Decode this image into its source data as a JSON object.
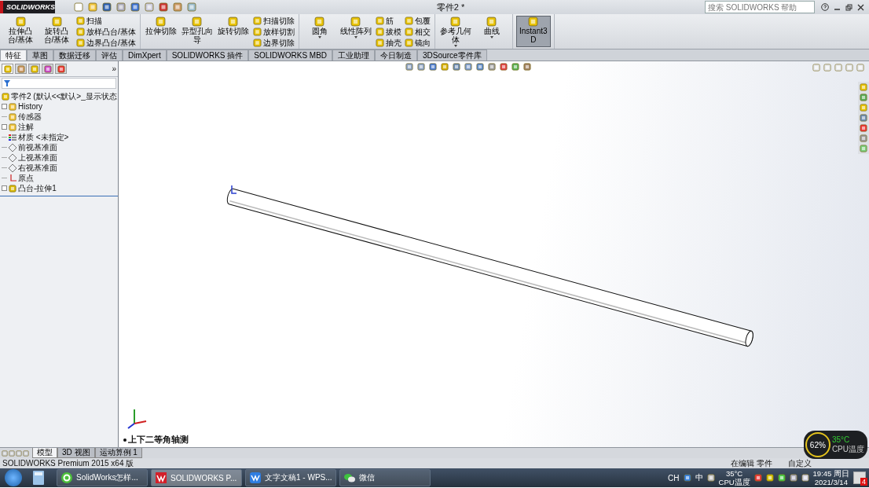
{
  "title_bar": {
    "logo": "SOLIDWORKS",
    "title": "零件2 *",
    "search": {
      "placeholder": "搜索 SOLIDWORKS 帮助"
    }
  },
  "ribbon": {
    "groups": [
      {
        "items": [
          {
            "label": "拉伸凸台/基体",
            "kind": "large",
            "dropdown": false,
            "pressed": false
          },
          {
            "label": "旋转凸台/基体",
            "kind": "large",
            "dropdown": false,
            "pressed": false
          },
          {
            "label": "扫描",
            "kind": "small",
            "dropdown": false,
            "pressed": false
          },
          {
            "label": "放样凸台/基体",
            "kind": "small",
            "dropdown": false,
            "pressed": false
          },
          {
            "label": "边界凸台/基体",
            "kind": "small",
            "dropdown": false,
            "pressed": false
          }
        ]
      },
      {
        "items": [
          {
            "label": "拉伸切除",
            "kind": "large",
            "dropdown": false,
            "pressed": false
          },
          {
            "label": "异型孔向导",
            "kind": "large",
            "dropdown": false,
            "pressed": false
          },
          {
            "label": "旋转切除",
            "kind": "large",
            "dropdown": false,
            "pressed": false
          },
          {
            "label": "扫描切除",
            "kind": "small",
            "dropdown": false,
            "pressed": false
          },
          {
            "label": "放样切割",
            "kind": "small",
            "dropdown": false,
            "pressed": false
          },
          {
            "label": "边界切除",
            "kind": "small",
            "dropdown": false,
            "pressed": false
          }
        ]
      },
      {
        "items": [
          {
            "label": "圆角",
            "kind": "large",
            "dropdown": true,
            "pressed": false
          },
          {
            "label": "线性阵列",
            "kind": "large",
            "dropdown": true,
            "pressed": false
          },
          {
            "label": "筋",
            "kind": "small",
            "dropdown": false,
            "pressed": false
          },
          {
            "label": "拔模",
            "kind": "small",
            "dropdown": false,
            "pressed": false
          },
          {
            "label": "抽壳",
            "kind": "small",
            "dropdown": false,
            "pressed": false
          },
          {
            "label": "包覆",
            "kind": "small",
            "dropdown": false,
            "pressed": false
          },
          {
            "label": "相交",
            "kind": "small",
            "dropdown": false,
            "pressed": false
          },
          {
            "label": "镜向",
            "kind": "small",
            "dropdown": false,
            "pressed": false
          }
        ]
      },
      {
        "items": [
          {
            "label": "参考几何体",
            "kind": "large",
            "dropdown": true,
            "pressed": false
          },
          {
            "label": "曲线",
            "kind": "large",
            "dropdown": true,
            "pressed": false
          }
        ]
      },
      {
        "items": [
          {
            "label": "Instant3D",
            "kind": "large",
            "dropdown": false,
            "pressed": true
          }
        ]
      }
    ]
  },
  "command_tabs": [
    {
      "label": "特征",
      "selected": true
    },
    {
      "label": "草图",
      "selected": false
    },
    {
      "label": "数据迁移",
      "selected": false
    },
    {
      "label": "评估",
      "selected": false
    },
    {
      "label": "DimXpert",
      "selected": false
    },
    {
      "label": "SOLIDWORKS 插件",
      "selected": false
    },
    {
      "label": "SOLIDWORKS MBD",
      "selected": false
    },
    {
      "label": "工业助理",
      "selected": false
    },
    {
      "label": "今日制造",
      "selected": false
    },
    {
      "label": "3DSource零件库",
      "selected": false
    }
  ],
  "feature_tree": {
    "more": "»",
    "panel_tabs": [
      {
        "selected": true
      },
      {
        "selected": false
      },
      {
        "selected": false
      },
      {
        "selected": false
      },
      {
        "selected": false
      }
    ],
    "root": "零件2 (默认<<默认>_显示状态",
    "items": [
      {
        "label": "History",
        "kind": "history",
        "expandable": true
      },
      {
        "label": "传感器",
        "kind": "sensors",
        "expandable": false
      },
      {
        "label": "注解",
        "kind": "annotations",
        "expandable": true
      },
      {
        "label": "材质 <未指定>",
        "kind": "material",
        "expandable": false
      },
      {
        "label": "前视基准面",
        "kind": "plane",
        "expandable": false
      },
      {
        "label": "上视基准面",
        "kind": "plane",
        "expandable": false
      },
      {
        "label": "右视基准面",
        "kind": "plane",
        "expandable": false
      },
      {
        "label": "原点",
        "kind": "origin",
        "expandable": false
      },
      {
        "label": "凸台-拉伸1",
        "kind": "feature",
        "expandable": true
      }
    ]
  },
  "viewport": {
    "view_label": "上下二等角轴测"
  },
  "model_tabs": [
    {
      "label": "模型",
      "selected": true
    },
    {
      "label": "3D 视图",
      "selected": false
    },
    {
      "label": "运动算例 1",
      "selected": false
    }
  ],
  "status_bar": {
    "product": "SOLIDWORKS Premium 2015 x64 版",
    "mode": "在编辑 零件",
    "units": "自定义"
  },
  "cpu_widget": {
    "usage": "62%",
    "temperature": "35°C",
    "label": "CPU温度"
  },
  "taskbar": {
    "items": [
      {
        "label": "SolidWorks怎样...",
        "kind": "browser",
        "selected": false
      },
      {
        "label": "SOLIDWORKS P...",
        "kind": "solidworks",
        "selected": true
      },
      {
        "label": "文字文稿1 - WPS...",
        "kind": "wps",
        "selected": false
      },
      {
        "label": "微信",
        "kind": "chat",
        "selected": false
      }
    ],
    "tray": {
      "language": "CH",
      "ime": "中",
      "temperature": "35°C",
      "temperature_label": "CPU温度",
      "time": "19:45 周日",
      "date": "2021/3/14",
      "badge": "4"
    }
  }
}
